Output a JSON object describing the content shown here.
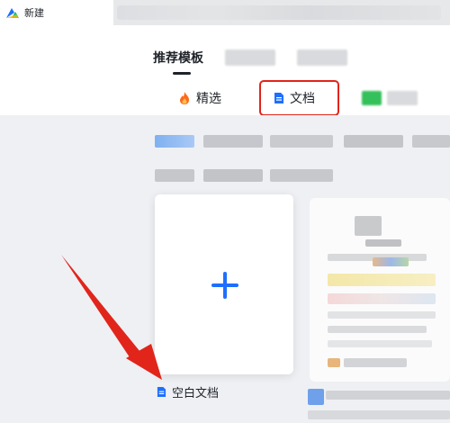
{
  "window": {
    "tab_title": "新建"
  },
  "header": {
    "top_tabs": [
      {
        "label": "推荐模板"
      }
    ]
  },
  "subtabs": [
    {
      "label": "精选",
      "icon": "flame-icon"
    },
    {
      "label": "文档",
      "icon": "doc-icon"
    }
  ],
  "blank_template": {
    "label": "空白文档",
    "icon": "doc-icon"
  },
  "colors": {
    "accent": "#1f6fff",
    "highlight": "#e1251b",
    "arrow": "#e1251b",
    "flame": "#ff6a1a"
  }
}
